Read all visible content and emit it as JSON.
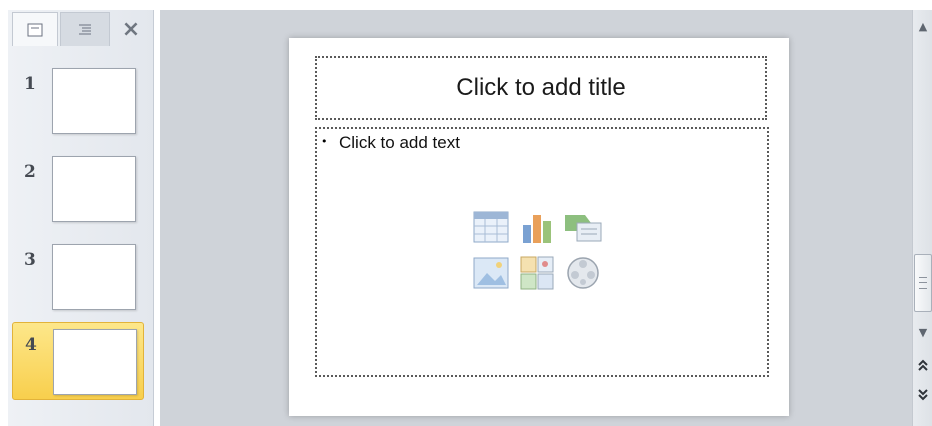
{
  "thumbnail_pane": {
    "tabs": [
      {
        "name": "slides-tab",
        "icon": "slide-icon"
      },
      {
        "name": "outline-tab",
        "icon": "outline-icon"
      }
    ],
    "close_label": "×",
    "slides": [
      {
        "number": "1",
        "selected": false
      },
      {
        "number": "2",
        "selected": false
      },
      {
        "number": "3",
        "selected": false
      },
      {
        "number": "4",
        "selected": true
      }
    ]
  },
  "slide": {
    "title_placeholder": "Click to add title",
    "content_bullet": "•",
    "content_placeholder": "Click to add text",
    "insert_icons": [
      "insert-table-icon",
      "insert-chart-icon",
      "insert-smartart-icon",
      "insert-picture-icon",
      "insert-clip-art-icon",
      "insert-media-icon"
    ]
  },
  "scrollbar": {
    "up_arrow": "▲",
    "down_arrow": "▼"
  },
  "colors": {
    "selected_slide": "#f8cf4d",
    "pane_bg": "#e3e7ed",
    "editor_bg": "#cfd3d9"
  }
}
